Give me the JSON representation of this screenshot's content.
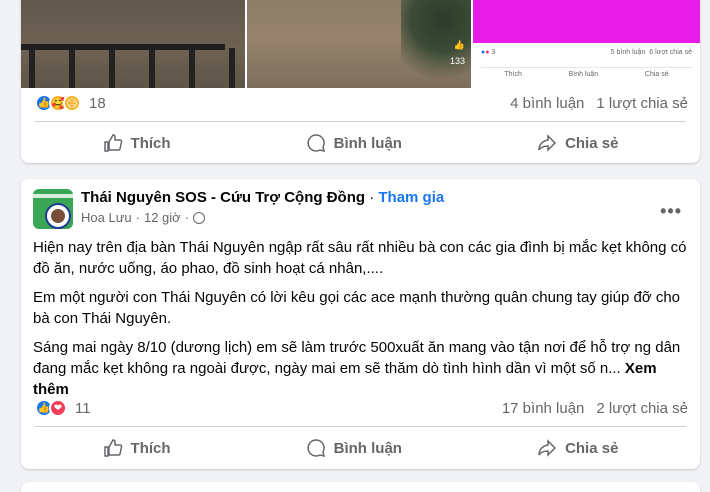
{
  "post1": {
    "media_tile_video_count": "133",
    "embedded": {
      "left_count": "3",
      "comments": "5 bình luận",
      "shares": "6 lượt chia sẻ",
      "actions": [
        "Thích",
        "Bình luận",
        "Chia sẻ"
      ]
    },
    "reaction_count": "18",
    "comments": "4 bình luận",
    "shares": "1 lượt chia sẻ",
    "actions": {
      "like": "Thích",
      "comment": "Bình luận",
      "share": "Chia sẻ"
    }
  },
  "post2": {
    "group_name": "Thái Nguyên SOS - Cứu Trợ Cộng Đồng",
    "separator": "·",
    "join": "Tham gia",
    "author": "Hoa Lưu",
    "time": "12 giờ",
    "more": "•••",
    "paragraphs": [
      "Hiện nay trên địa bàn Thái Nguyên ngập rất sâu rất nhiều bà con các gia đình bị mắc kẹt không có đồ ăn, nước uống, áo phao, đồ sinh hoạt cá nhân,....",
      "Em một người con Thái Nguyên có lời kêu gọi các ace mạnh thường quân chung tay giúp đỡ cho bà con Thái Nguyên.",
      "Sáng mai ngày 8/10 (dương lịch) em sẽ làm trước 500xuất ăn mang vào tận nơi để hỗ trợ ng dân đang mắc kẹt không ra ngoài được, ngày mai em sẽ thăm dò tình hình dần vì một số n..."
    ],
    "see_more": "Xem thêm",
    "reaction_count": "11",
    "comments": "17 bình luận",
    "shares": "2 lượt chia sẻ",
    "actions": {
      "like": "Thích",
      "comment": "Bình luận",
      "share": "Chia sẻ"
    }
  },
  "colors": {
    "accent": "#1877f2",
    "love": "#f33e58",
    "secondary_text": "#65676b"
  }
}
